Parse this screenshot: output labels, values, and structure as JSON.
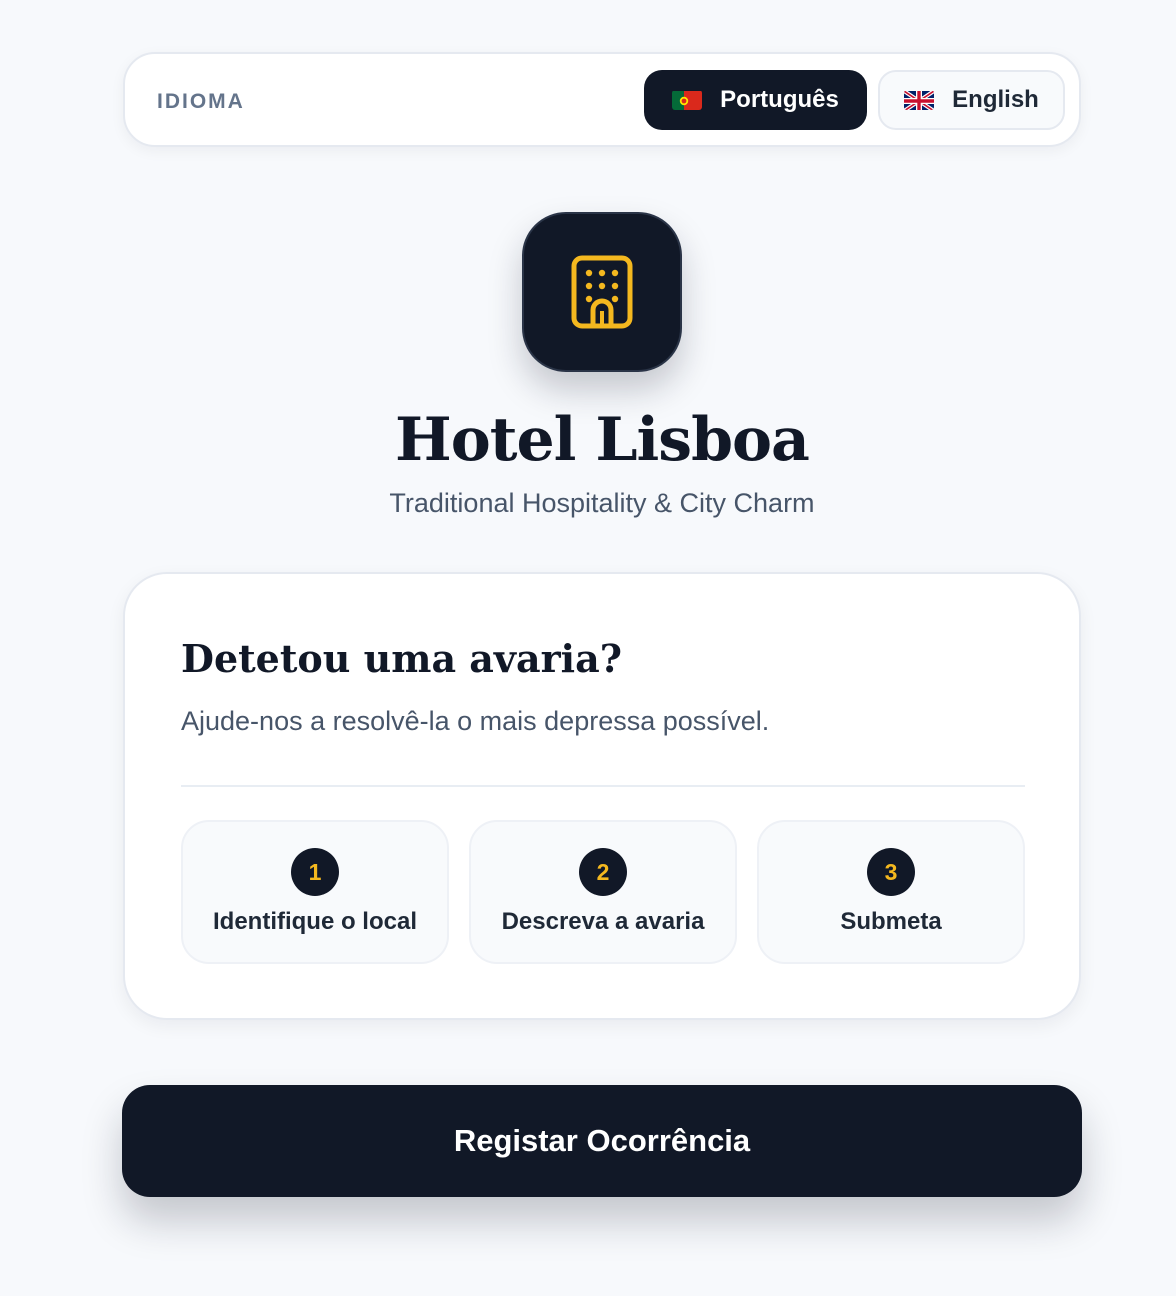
{
  "language": {
    "label": "IDIOMA",
    "options": [
      {
        "label": "Português",
        "flag": "portugal-flag-icon",
        "selected": true
      },
      {
        "label": "English",
        "flag": "uk-flag-icon",
        "selected": false
      }
    ]
  },
  "brand": {
    "icon": "hotel-building-icon",
    "name": "Hotel Lisboa",
    "tagline": "Traditional Hospitality & City Charm"
  },
  "card": {
    "title": "Detetou uma avaria?",
    "subtitle": "Ajude-nos a resolvê-la o mais depressa possível.",
    "steps": [
      {
        "number": "1",
        "label": "Identifique o local"
      },
      {
        "number": "2",
        "label": "Descreva a avaria"
      },
      {
        "number": "3",
        "label": "Submeta"
      }
    ]
  },
  "cta": {
    "label": "Registar Ocorrência"
  },
  "colors": {
    "primary": "#111827",
    "accent": "#f4b81f",
    "background": "#f7f9fc",
    "muted_text": "#475569"
  }
}
